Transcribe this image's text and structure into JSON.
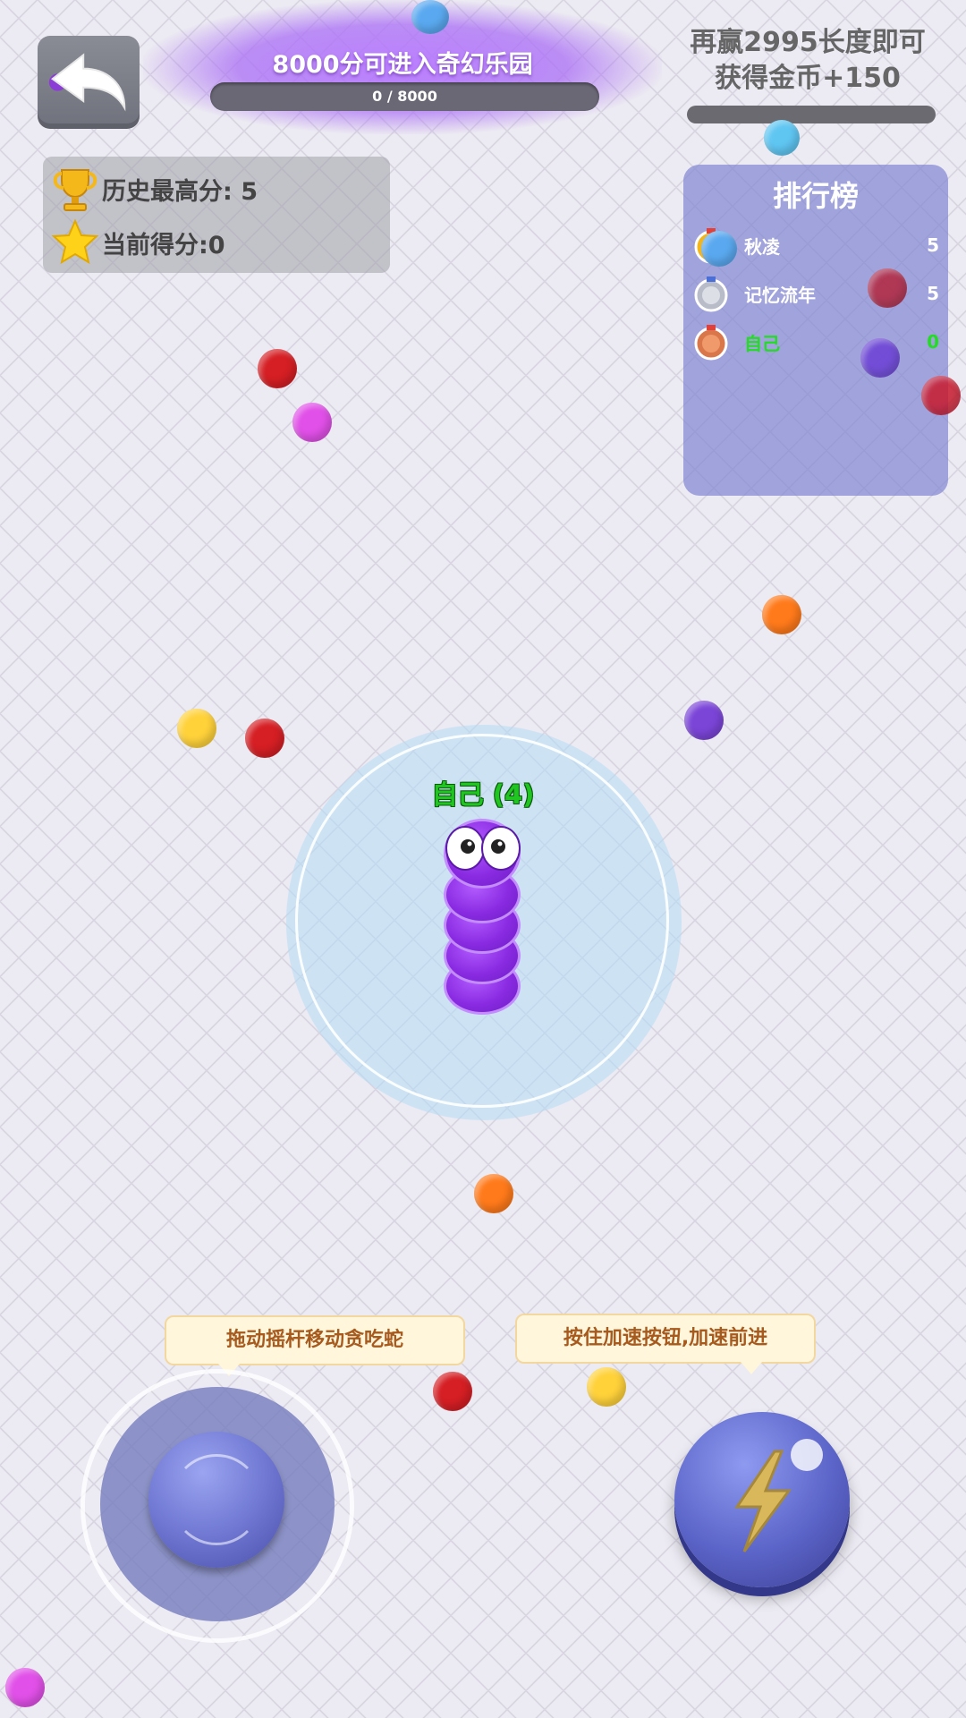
{
  "hud": {
    "back_label": "",
    "banner_text": "8000分可进入奇幻乐园",
    "progress_text": "0 / 8000",
    "progress_fraction": 0,
    "goal_line1": "再赢2995长度即可",
    "goal_line2": "获得金币+150",
    "high_score_label": "历史最高分: 5",
    "current_score_label": "当前得分:0"
  },
  "leaderboard": {
    "title": "排行榜",
    "rows": [
      {
        "name": "秋凌",
        "score": "5",
        "medal": "gold",
        "color": "#ffffff"
      },
      {
        "name": "记忆流年",
        "score": "5",
        "medal": "silver",
        "color": "#ffffff"
      },
      {
        "name": "自己",
        "score": "0",
        "medal": "bronze",
        "color": "#22dd22"
      }
    ]
  },
  "player": {
    "name": "自己 (4)",
    "color": "#8a2be2"
  },
  "tips": {
    "joystick": "拖动摇杆移动贪吃蛇",
    "boost": "按住加速按钮,加速前进"
  },
  "icons": {
    "back": "back-arrow-icon",
    "trophy": "trophy-icon",
    "star": "star-icon",
    "boost": "lightning-icon"
  }
}
